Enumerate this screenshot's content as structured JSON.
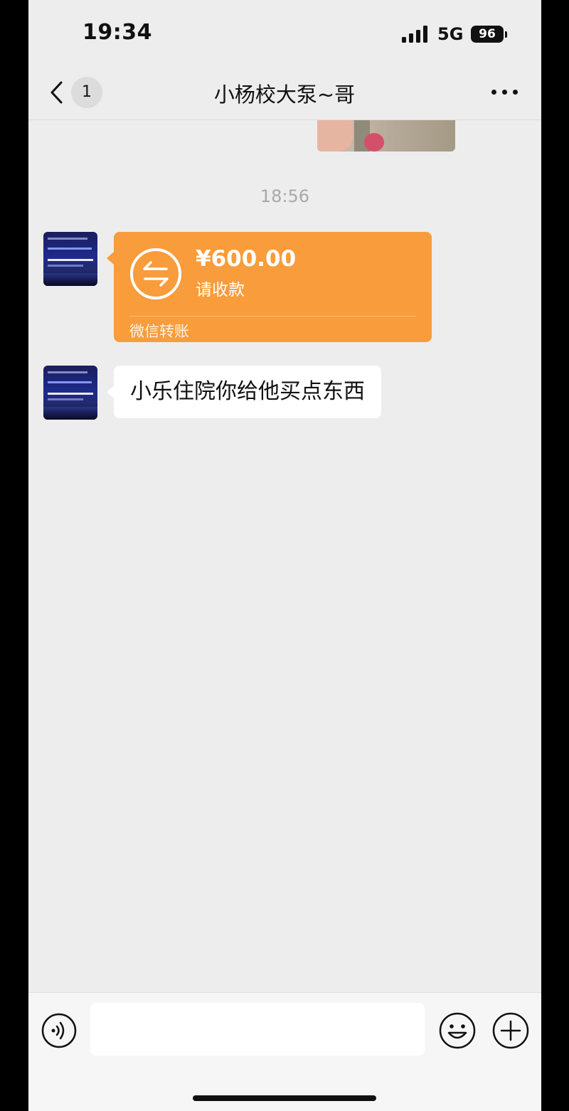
{
  "status_bar": {
    "time": "19:34",
    "network": "5G",
    "battery": "96",
    "icons": [
      "signal-icon",
      "battery-icon"
    ]
  },
  "nav": {
    "back_icon": "chevron-left-icon",
    "unread_count": "1",
    "title": "小杨校大泵~哥",
    "more_icon": "more-dots-icon"
  },
  "messages": {
    "timestamp": "18:56",
    "transfer": {
      "amount": "¥600.00",
      "status": "请收款",
      "footer": "微信转账",
      "icon": "transfer-arrows-icon"
    },
    "text": "小乐住院你给他买点东西"
  },
  "input_bar": {
    "voice_icon": "voice-icon",
    "placeholder": "",
    "emoji_icon": "emoji-icon",
    "plus_icon": "plus-circle-icon"
  },
  "colors": {
    "background": "#ededed",
    "transfer_card": "#f99c3b",
    "bubble": "#ffffff",
    "timestamp": "#a8a8a8"
  }
}
